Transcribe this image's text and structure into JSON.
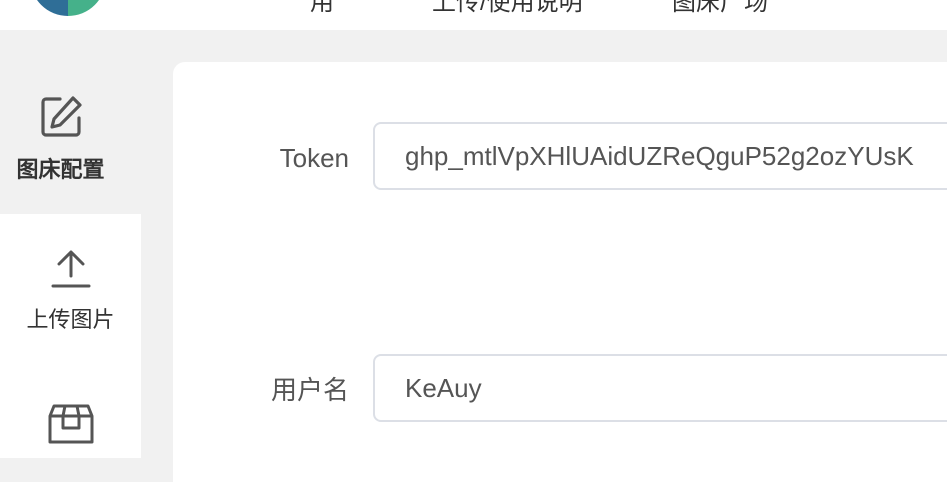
{
  "header": {
    "nav": [
      "用",
      "上传/使用说明",
      "图床广场"
    ]
  },
  "sidebar": {
    "items": [
      {
        "label": "图床配置",
        "icon": "edit-icon",
        "active": true
      },
      {
        "label": "上传图片",
        "icon": "upload-icon",
        "active": false
      },
      {
        "label": "",
        "icon": "package-icon",
        "active": false
      }
    ]
  },
  "form": {
    "token": {
      "label": "Token",
      "value": "ghp_mtlVpXHlUAidUZReQguP52g2ozYUsK"
    },
    "username": {
      "label": "用户名",
      "value": "KeAuy"
    }
  }
}
